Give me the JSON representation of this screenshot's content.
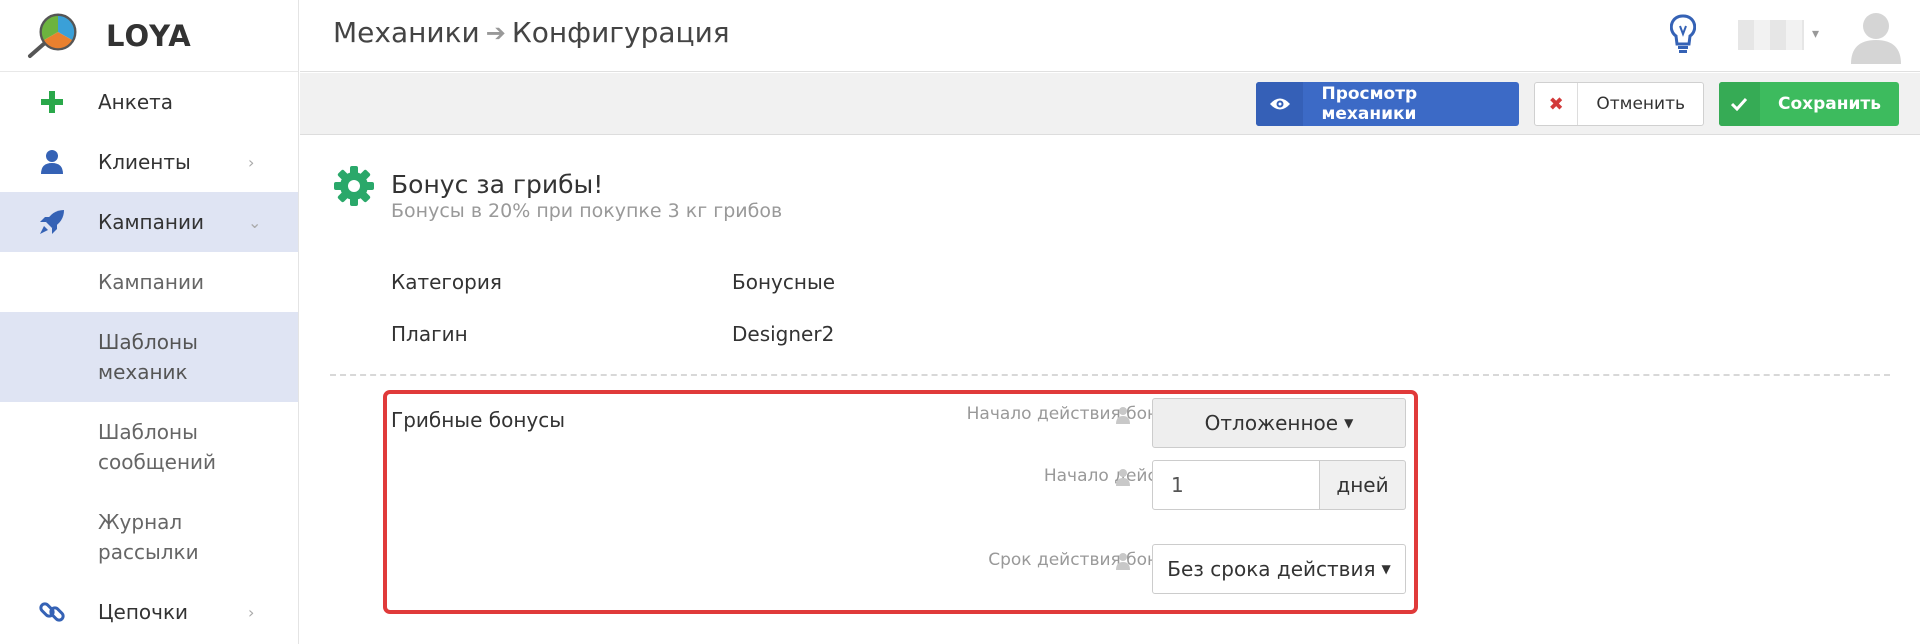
{
  "brand": {
    "name": "LOYA"
  },
  "sidebar": {
    "items": [
      {
        "label": "Анкета",
        "icon": "plus-icon",
        "color": "#2aa84a"
      },
      {
        "label": "Клиенты",
        "icon": "user-icon",
        "color": "#3562b5",
        "chevron": "›"
      },
      {
        "label": "Кампании",
        "icon": "rocket-icon",
        "color": "#3562b5",
        "chevron": "⌄"
      },
      {
        "label": "Цепочки",
        "icon": "chain-link-icon",
        "color": "#3562b5",
        "chevron": "›"
      }
    ],
    "subitems": [
      {
        "label": "Кампании"
      },
      {
        "label": "Шаблоны механик"
      },
      {
        "label": "Шаблоны сообщений"
      },
      {
        "label": "Журнал рассылки"
      }
    ]
  },
  "header": {
    "breadcrumb_1": "Механики",
    "breadcrumb_2": "Конфигурация",
    "arrow": "➔",
    "user_caret": "▾"
  },
  "toolbar": {
    "view_label": "Просмотр механики",
    "cancel_label": "Отменить",
    "cancel_icon": "✖",
    "save_label": "Сохранить",
    "accent_blue": "#3c6ac6",
    "accent_green": "#3dbb5e",
    "accent_red": "#d23b3b"
  },
  "mechanic": {
    "title": "Бонус за грибы!",
    "subtitle": "Бонусы в 20% при покупке 3 кг грибов",
    "props": [
      {
        "key": "Категория",
        "value": "Бонусные"
      },
      {
        "key": "Плагин",
        "value": "Designer2"
      }
    ]
  },
  "form": {
    "group_title": "Грибные бонусы",
    "bonus_start_label": "Начало действия бонусов",
    "bonus_start_value": "Отложенное",
    "start_label": "Начало действия",
    "start_value": "1",
    "start_unit": "дней",
    "term_label": "Срок действия бонусов",
    "term_value": "Без срока действия",
    "caret": "▼"
  }
}
